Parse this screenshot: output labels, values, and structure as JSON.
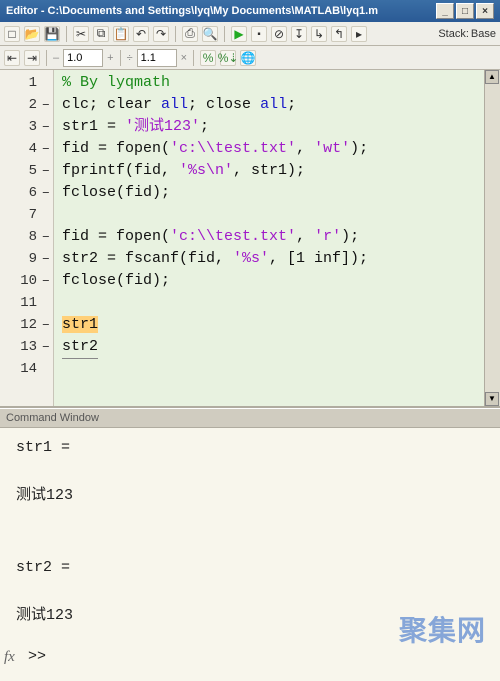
{
  "window": {
    "title": "Editor - C:\\Documents and Settings\\lyq\\My Documents\\MATLAB\\lyq1.m"
  },
  "toolbar1": {
    "new": "□",
    "open": "📂",
    "save": "💾",
    "cut": "✂",
    "copy": "⧉",
    "paste": "📋",
    "undo": "↶",
    "redo": "↷",
    "print": "⎙",
    "find": "🔍"
  },
  "toolbar2": {
    "indent_out": "⇤",
    "indent_in": "⇥",
    "field1": "1.0",
    "plus": "+",
    "field2": "1.1",
    "times": "×",
    "run": "▶",
    "earth": "🌐"
  },
  "stack": {
    "label": "Stack:",
    "value": "Base"
  },
  "gutter": [
    "1",
    "2",
    "3",
    "4",
    "5",
    "6",
    "7",
    "8",
    "9",
    "10",
    "11",
    "12",
    "13",
    "14"
  ],
  "breaklines": [
    2,
    3,
    4,
    5,
    6,
    8,
    9,
    10,
    12,
    13
  ],
  "code": {
    "l1": "% By lyqmath",
    "l2a": "clc; clear ",
    "l2b": "all",
    "l2c": "; close ",
    "l2d": "all",
    "l2e": ";",
    "l3a": "str1 = ",
    "l3b": "'测试123'",
    "l3c": ";",
    "l4a": "fid = fopen(",
    "l4b": "'c:\\\\test.txt'",
    "l4c": ", ",
    "l4d": "'wt'",
    "l4e": ");",
    "l5a": "fprintf(fid, ",
    "l5b": "'%s\\n'",
    "l5c": ", str1);",
    "l6": "fclose(fid);",
    "l8a": "fid = fopen(",
    "l8b": "'c:\\\\test.txt'",
    "l8c": ", ",
    "l8d": "'r'",
    "l8e": ");",
    "l9a": "str2 = fscanf(fid, ",
    "l9b": "'%s'",
    "l9c": ", [1 inf]);",
    "l10": "fclose(fid);",
    "l12": "str1",
    "l13": "str2"
  },
  "cmd": {
    "title": "Command Window",
    "out1": "str1 =",
    "out2": "测试123",
    "out3": "str2 =",
    "out4": "测试123",
    "fx": "fx",
    "prompt": ">>"
  },
  "watermark": "聚集网"
}
